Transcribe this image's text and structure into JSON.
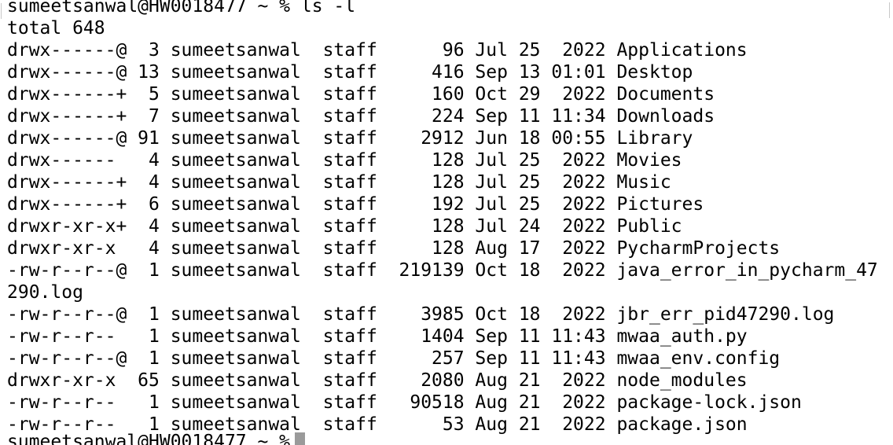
{
  "terminal": {
    "prompt": "sumeetsanwal@HW0018477 ~ % ls -l",
    "total": "total 648",
    "rows": [
      "drwx------@  3 sumeetsanwal  staff      96 Jul 25  2022 Applications",
      "drwx------@ 13 sumeetsanwal  staff     416 Sep 13 01:01 Desktop",
      "drwx------+  5 sumeetsanwal  staff     160 Oct 29  2022 Documents",
      "drwx------+  7 sumeetsanwal  staff     224 Sep 11 11:34 Downloads",
      "drwx------@ 91 sumeetsanwal  staff    2912 Jun 18 00:55 Library",
      "drwx------   4 sumeetsanwal  staff     128 Jul 25  2022 Movies",
      "drwx------+  4 sumeetsanwal  staff     128 Jul 25  2022 Music",
      "drwx------+  6 sumeetsanwal  staff     192 Jul 25  2022 Pictures",
      "drwxr-xr-x+  4 sumeetsanwal  staff     128 Jul 24  2022 Public",
      "drwxr-xr-x   4 sumeetsanwal  staff     128 Aug 17  2022 PycharmProjects",
      "-rw-r--r--@  1 sumeetsanwal  staff  219139 Oct 18  2022 java_error_in_pycharm_47",
      "290.log",
      "-rw-r--r--@  1 sumeetsanwal  staff    3985 Oct 18  2022 jbr_err_pid47290.log",
      "-rw-r--r--   1 sumeetsanwal  staff    1404 Sep 11 11:43 mwaa_auth.py",
      "-rw-r--r--@  1 sumeetsanwal  staff     257 Sep 11 11:43 mwaa_env.config",
      "drwxr-xr-x  65 sumeetsanwal  staff    2080 Aug 21  2022 node_modules",
      "-rw-r--r--   1 sumeetsanwal  staff   90518 Aug 21  2022 package-lock.json",
      "-rw-r--r--   1 sumeetsanwal  staff      53 Aug 21  2022 package.json"
    ],
    "next_prompt": "sumeetsanwal@HW0018477 ~ %",
    "cursor_color": "#9a9a9a"
  }
}
